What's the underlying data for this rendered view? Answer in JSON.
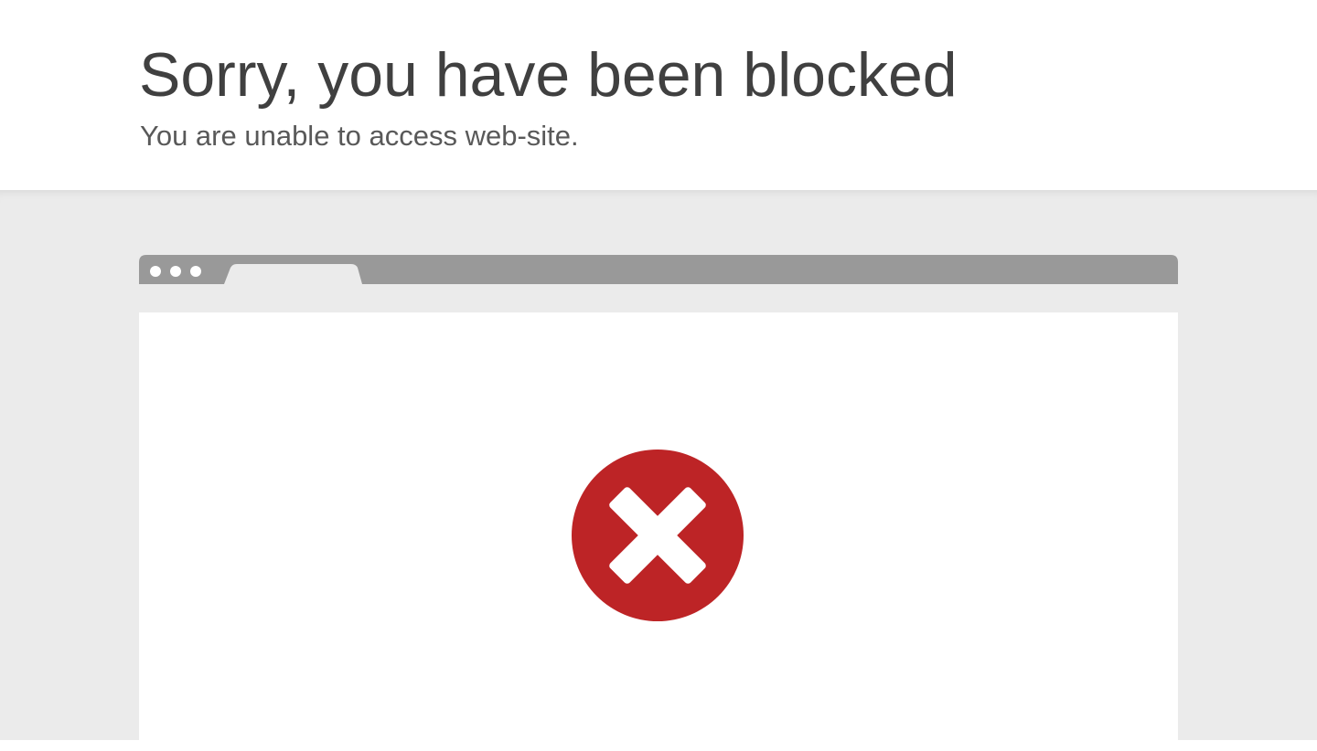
{
  "page": {
    "title": "Sorry, you have been blocked",
    "subtitle": "You are unable to access web-site."
  },
  "colors": {
    "title_text": "#404040",
    "subtitle_text": "#595959",
    "stage_background": "#ebebeb",
    "chrome_gray": "#999999",
    "error_red": "#bd2426",
    "window_background": "#ffffff"
  },
  "icons": {
    "window_dots": "three-dots-icon",
    "blocked": "blocked-x-icon"
  }
}
